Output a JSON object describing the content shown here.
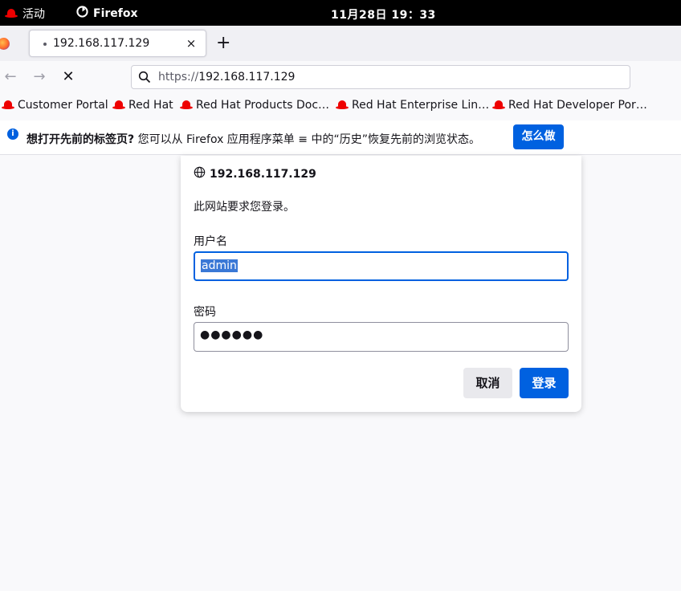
{
  "topbar": {
    "activities": "活动",
    "app": "Firefox",
    "clock": "11月28日  19：33"
  },
  "tab": {
    "title": "192.168.117.129",
    "close": "×",
    "new_tab": "+"
  },
  "nav": {
    "back": "←",
    "forward": "→",
    "stop": "✕"
  },
  "urlbar": {
    "scheme": "https://",
    "host": "192.168.117.129"
  },
  "bookmarks": [
    "Customer Portal",
    "Red Hat",
    "Red Hat Products Doc…",
    "Red Hat Enterprise Lin…",
    "Red Hat Developer Por…"
  ],
  "infobar": {
    "icon": "i",
    "bold": "想打开先前的标签页?",
    "text": " 您可以从 Firefox 应用程序菜单 ≡ 中的“历史”恢复先前的浏览状态。",
    "button": "怎么做"
  },
  "dialog": {
    "host": "192.168.117.129",
    "message": "此网站要求您登录。",
    "username_label": "用户名",
    "username_value": "admin",
    "password_label": "密码",
    "password_value": "●●●●●●",
    "cancel": "取消",
    "login": "登录"
  },
  "colors": {
    "accent": "#0061e0",
    "topbar": "#000000"
  }
}
